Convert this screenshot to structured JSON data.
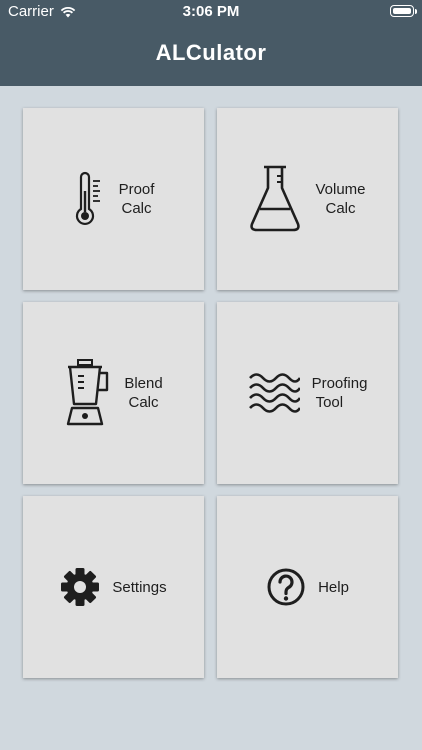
{
  "status_bar": {
    "carrier": "Carrier",
    "time": "3:06 PM"
  },
  "header": {
    "title": "ALCulator"
  },
  "tiles": [
    {
      "line1": "Proof",
      "line2": "Calc",
      "icon": "thermometer-icon"
    },
    {
      "line1": "Volume",
      "line2": "Calc",
      "icon": "flask-icon"
    },
    {
      "line1": "Blend",
      "line2": "Calc",
      "icon": "blender-icon"
    },
    {
      "line1": "Proofing",
      "line2": "Tool",
      "icon": "waves-icon"
    },
    {
      "line1": "Settings",
      "icon": "gear-icon"
    },
    {
      "line1": "Help",
      "icon": "help-icon"
    }
  ],
  "colors": {
    "header_bg": "#485a66",
    "page_bg": "#d0d8de",
    "tile_bg": "#e1e1e1",
    "icon": "#1e1e1e"
  }
}
